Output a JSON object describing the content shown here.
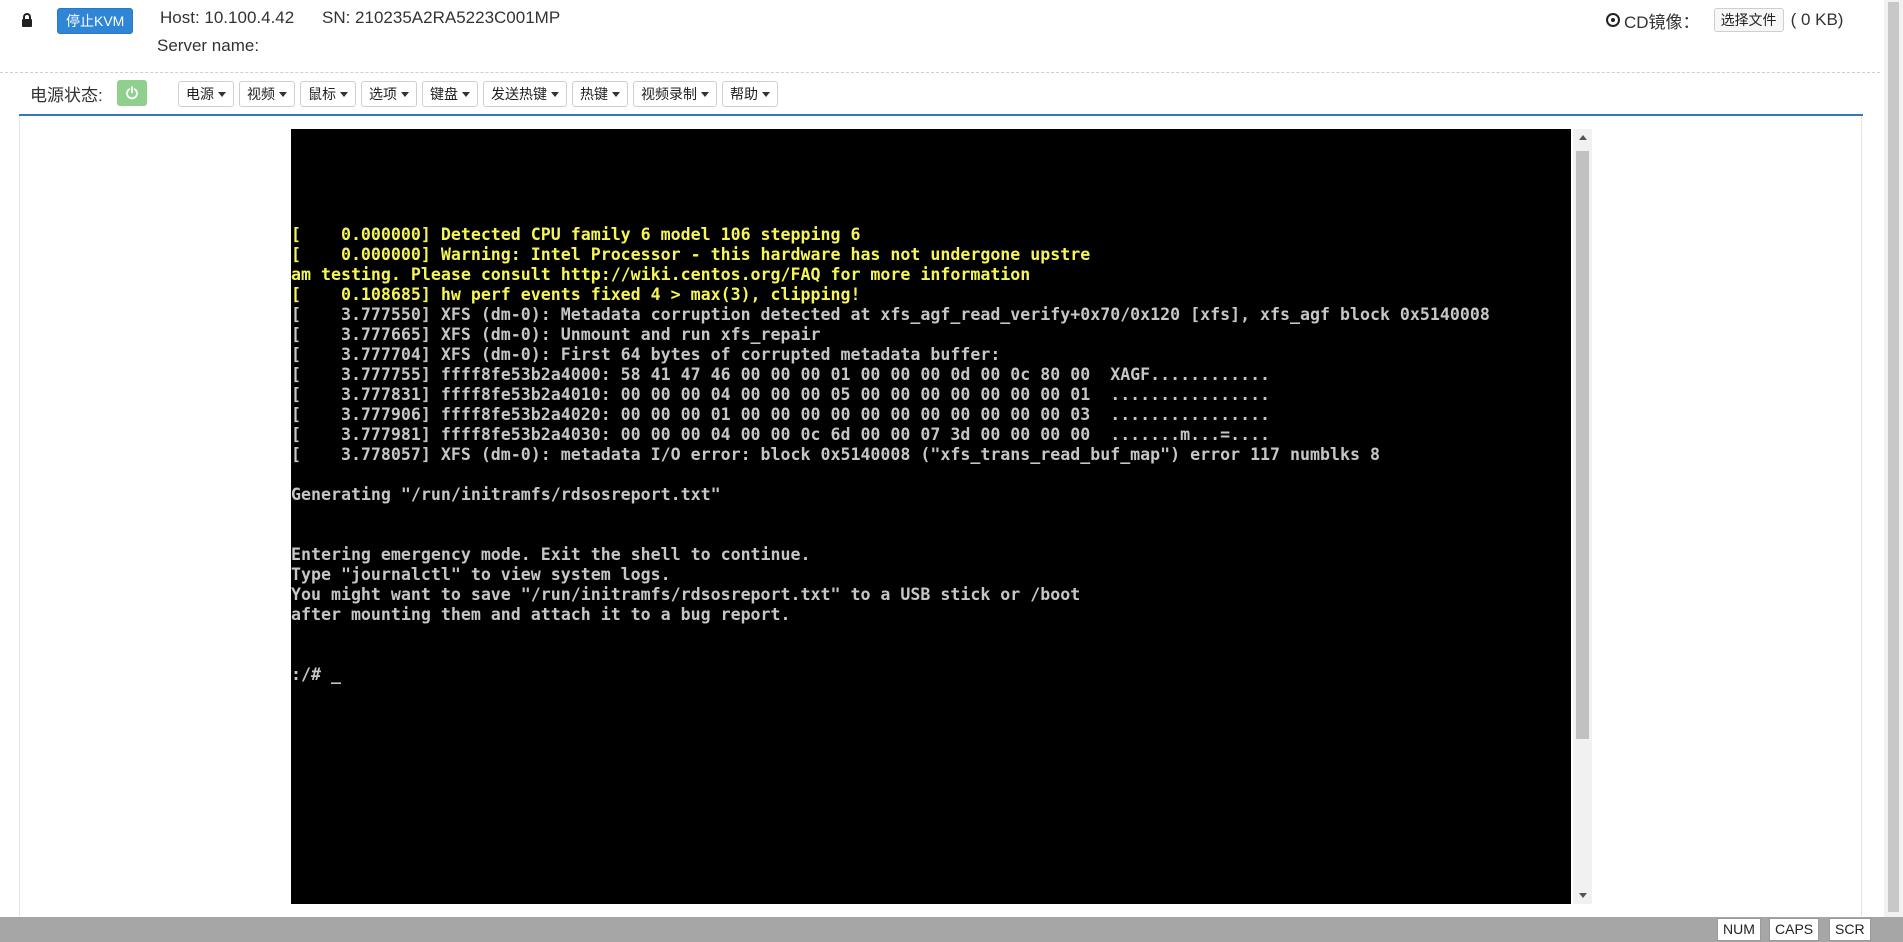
{
  "header": {
    "kvm_button": "停止KVM",
    "host": "Host: 10.100.4.42",
    "sn": "SN: 210235A2RA5223C001MP",
    "server_name": "Server name:",
    "cd_label": "CD镜像：",
    "choose_file": "选择文件",
    "file_size": "( 0 KB)"
  },
  "toolbar": {
    "power_label": "电源状态:",
    "power_state_color": "#8fd08f",
    "menus": [
      {
        "label": "电源"
      },
      {
        "label": "视频"
      },
      {
        "label": "鼠标"
      },
      {
        "label": "选项"
      },
      {
        "label": "键盘"
      },
      {
        "label": "发送热键"
      },
      {
        "label": "热键"
      },
      {
        "label": "视频录制"
      },
      {
        "label": "帮助"
      }
    ]
  },
  "console": {
    "lines": [
      {
        "text": "[    0.000000] Detected CPU family 6 model 106 stepping 6",
        "color": "yellow"
      },
      {
        "text": "[    0.000000] Warning: Intel Processor - this hardware has not undergone upstre",
        "color": "yellow"
      },
      {
        "text": "am testing. Please consult http://wiki.centos.org/FAQ for more information",
        "color": "yellow"
      },
      {
        "text": "[    0.108685] hw perf events fixed 4 > max(3), clipping!",
        "color": "yellow"
      },
      {
        "text": "[    3.777550] XFS (dm-0): Metadata corruption detected at xfs_agf_read_verify+0x70/0x120 [xfs], xfs_agf block 0x5140008",
        "color": "white"
      },
      {
        "text": "[    3.777665] XFS (dm-0): Unmount and run xfs_repair",
        "color": "white"
      },
      {
        "text": "[    3.777704] XFS (dm-0): First 64 bytes of corrupted metadata buffer:",
        "color": "white"
      },
      {
        "text": "[    3.777755] ffff8fe53b2a4000: 58 41 47 46 00 00 00 01 00 00 00 0d 00 0c 80 00  XAGF............",
        "color": "white"
      },
      {
        "text": "[    3.777831] ffff8fe53b2a4010: 00 00 00 04 00 00 00 05 00 00 00 00 00 00 00 01  ................",
        "color": "white"
      },
      {
        "text": "[    3.777906] ffff8fe53b2a4020: 00 00 00 01 00 00 00 00 00 00 00 00 00 00 00 03  ................",
        "color": "white"
      },
      {
        "text": "[    3.777981] ffff8fe53b2a4030: 00 00 00 04 00 00 0c 6d 00 00 07 3d 00 00 00 00  .......m...=....",
        "color": "white"
      },
      {
        "text": "[    3.778057] XFS (dm-0): metadata I/O error: block 0x5140008 (\"xfs_trans_read_buf_map\") error 117 numblks 8",
        "color": "white"
      },
      {
        "text": "",
        "color": "white"
      },
      {
        "text": "Generating \"/run/initramfs/rdsosreport.txt\"",
        "color": "white"
      },
      {
        "text": "",
        "color": "white"
      },
      {
        "text": "",
        "color": "white"
      },
      {
        "text": "Entering emergency mode. Exit the shell to continue.",
        "color": "white"
      },
      {
        "text": "Type \"journalctl\" to view system logs.",
        "color": "white"
      },
      {
        "text": "You might want to save \"/run/initramfs/rdsosreport.txt\" to a USB stick or /boot",
        "color": "white"
      },
      {
        "text": "after mounting them and attach it to a bug report.",
        "color": "white"
      },
      {
        "text": "",
        "color": "white"
      },
      {
        "text": "",
        "color": "white"
      },
      {
        "text": ":/# _",
        "color": "white"
      }
    ]
  },
  "status": {
    "num": "NUM",
    "caps": "CAPS",
    "scr": "SCR"
  }
}
